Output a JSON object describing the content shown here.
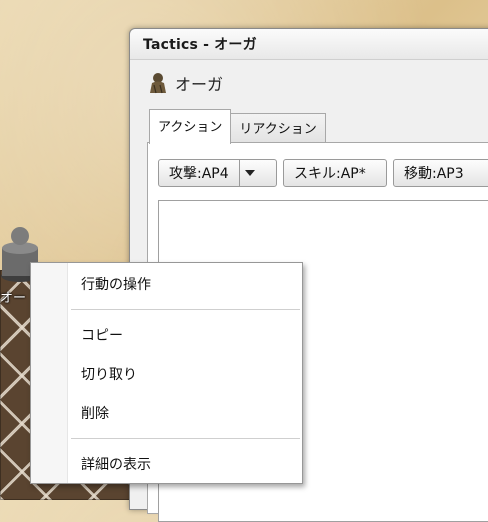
{
  "window": {
    "title": "Tactics - オーガ",
    "unit_name": "オーガ"
  },
  "tabs": [
    {
      "label": "アクション",
      "active": true
    },
    {
      "label": "リアクション",
      "active": false
    }
  ],
  "actions": {
    "attack_label": "攻撃:AP4",
    "skill_label": "スキル:AP*",
    "move_label": "移動:AP3"
  },
  "board": {
    "piece_label": "オー"
  },
  "context_menu": {
    "items": [
      "行動の操作",
      "コピー",
      "切り取り",
      "削除",
      "詳細の表示"
    ]
  },
  "icons": {
    "unit": "ogre-icon",
    "dropdown": "chevron-down-icon"
  }
}
